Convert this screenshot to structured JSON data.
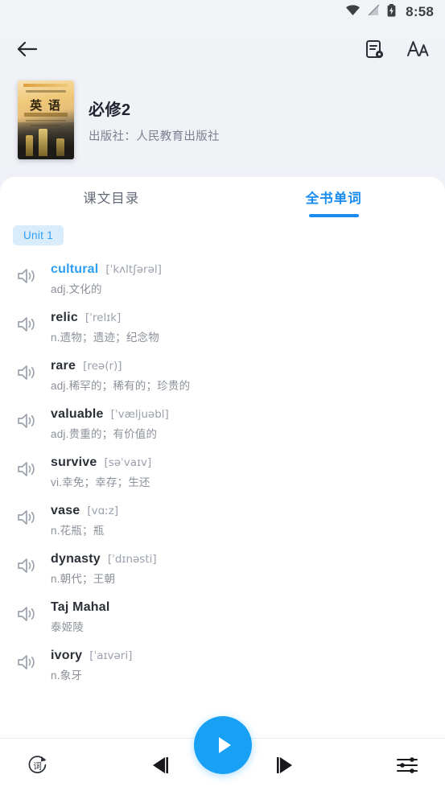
{
  "status_bar": {
    "time": "8:58",
    "icons": [
      "wifi-icon",
      "signal-off-icon",
      "battery-charging-icon"
    ]
  },
  "app_bar": {
    "back_icon": "back-arrow-icon",
    "note_icon": "note-settings-icon",
    "font_icon": "font-size-icon"
  },
  "book": {
    "cover_title": "英 语",
    "title": "必修2",
    "publisher": "出版社：人民教育出版社"
  },
  "tabs": [
    {
      "label": "课文目录",
      "active": false
    },
    {
      "label": "全书单词",
      "active": true
    }
  ],
  "unit_chip": "Unit 1",
  "words": [
    {
      "term": "cultural",
      "phonetic": "[ˈkʌltʃərəl]",
      "meaning": "adj.文化的",
      "highlight": true
    },
    {
      "term": "relic",
      "phonetic": "[ˈrelɪk]",
      "meaning": "n.遗物；遗迹；纪念物",
      "highlight": false
    },
    {
      "term": "rare",
      "phonetic": "[reə(r)]",
      "meaning": "adj.稀罕的；稀有的；珍贵的",
      "highlight": false
    },
    {
      "term": "valuable",
      "phonetic": "[ˈvæljuəbl]",
      "meaning": "adj.贵重的；有价值的",
      "highlight": false
    },
    {
      "term": "survive",
      "phonetic": "[səˈvaɪv]",
      "meaning": "vi.幸免；幸存；生还",
      "highlight": false
    },
    {
      "term": "vase",
      "phonetic": "[vɑːz]",
      "meaning": "n.花瓶；瓶",
      "highlight": false
    },
    {
      "term": "dynasty",
      "phonetic": "[ˈdɪnəsti]",
      "meaning": "n.朝代；王朝",
      "highlight": false
    },
    {
      "term": "Taj Mahal",
      "phonetic": "",
      "meaning": "泰姬陵",
      "highlight": false
    },
    {
      "term": "ivory",
      "phonetic": "[ˈaɪvəri]",
      "meaning": "n.象牙",
      "highlight": false
    }
  ],
  "player": {
    "repeat_word_icon": "repeat-word-icon",
    "repeat_word_glyph": "词",
    "previous_icon": "previous-track-icon",
    "play_icon": "play-icon",
    "next_icon": "next-track-icon",
    "settings_icon": "equalizer-settings-icon"
  },
  "colors": {
    "accent": "#18a0f5",
    "tab_active": "#1a8cf0",
    "chip_bg": "#d9ecfb",
    "chip_text": "#2e9ef5",
    "page_bg": "#eceef4",
    "card_bg": "#ffffff"
  }
}
